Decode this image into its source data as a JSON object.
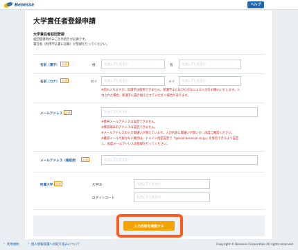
{
  "header": {
    "logo_text": "Benesse",
    "help_label": "ヘルプ"
  },
  "page": {
    "title": "大学責任者登録申請",
    "section_title": "大学責任者初回登録",
    "intro_lines": [
      "初回登録時のみこの手続きが必要です。",
      "責任者（利用申込書に記載）が登録を行ってください。"
    ]
  },
  "required_badge": "必須",
  "fields": {
    "name_kanji": {
      "label": "名前（漢字）",
      "last_label": "姓",
      "first_label": "名",
      "last_placeholder": "入力してください",
      "first_placeholder": "入力してください"
    },
    "name_kana": {
      "label": "名前（カナ）",
      "last_label": "セイ",
      "first_label": "メイ",
      "last_placeholder": "入力してください",
      "first_placeholder": "入力してください",
      "notes": [
        "※恐れ入りますが、旧漢字は使用できません。新漢字またはひらがなによる入力をお願いいたします。入",
        "力された場合、新漢字に置き換えさせていただく場合があります。"
      ]
    },
    "email": {
      "label": "メールアドレス",
      "placeholder": "入力してください",
      "notes": [
        "※携帯メールアドレスは設定できません。",
        "※携帯端末のアドレスは設定できません。",
        "※メールアドレスの入力間違いが増えています。入力内容に間違いが無いか、再度ご確認ください。",
        "※確認メールが届かない場合は、ドメイン指定設定で「@mail.benesse.co.jp」を受信できるよう設定",
        "し、再度メールアドレスの登録を行ってください。"
      ]
    },
    "email_confirm": {
      "label": "メールアドレス（確認用）",
      "placeholder": "入力してください"
    },
    "university": {
      "label": "所属大学",
      "id_label": "大学ID",
      "id_placeholder": "入力してください",
      "login_label": "ログインコード",
      "login_placeholder": "入力してください"
    }
  },
  "actions": {
    "submit_label": "入力内容を確認する"
  },
  "footer": {
    "links": [
      "利用規約",
      "個人情報保護への取り組みについて"
    ],
    "copyright": "Copyright © Benesse Corporation All rights reserved."
  },
  "colors": {
    "accent": "#1f67b1",
    "button": "#f4a400",
    "highlight": "#ff5a1f",
    "required": "#e08a00",
    "error": "#cc1a1a"
  }
}
